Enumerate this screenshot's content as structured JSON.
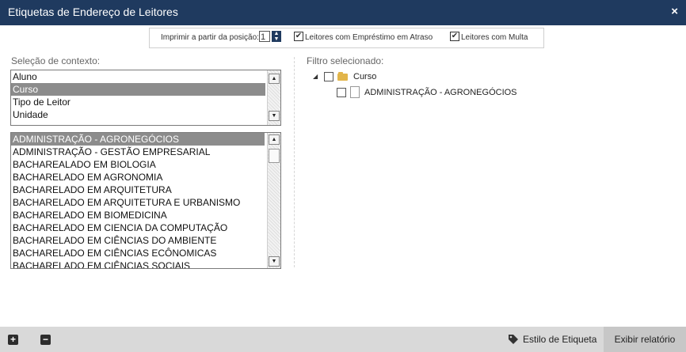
{
  "window": {
    "title": "Etiquetas de Endereço de Leitores",
    "close_glyph": "×"
  },
  "options": {
    "start_position_label": "Imprimir a partir da posição:",
    "start_position_value": "1",
    "overdue_loans_label": "Leitores com Empréstimo em Atraso",
    "overdue_loans_checked": true,
    "fines_label": "Leitores com Multa",
    "fines_checked": true
  },
  "context": {
    "label": "Seleção de contexto:",
    "types": [
      "Aluno",
      "Curso",
      "Tipo de Leitor",
      "Unidade"
    ],
    "selected_type": "Curso",
    "values": [
      "ADMINISTRAÇÃO - AGRONEGÓCIOS",
      "ADMINISTRAÇÃO - GESTÃO EMPRESARIAL",
      "BACHAREALADO EM BIOLOGIA",
      "BACHARELADO EM AGRONOMIA",
      "BACHARELADO EM ARQUITETURA",
      "BACHARELADO EM ARQUITETURA E URBANISMO",
      "BACHARELADO EM BIOMEDICINA",
      "BACHARELADO EM CIENCIA DA COMPUTAÇÃO",
      "BACHARELADO EM CIÊNCIAS DO AMBIENTE",
      "BACHARELADO EM CIÊNCIAS ECÔNOMICAS",
      "BACHARELADO EM CIÊNCIAS SOCIAIS"
    ],
    "selected_value": "ADMINISTRAÇÃO - AGRONEGÓCIOS"
  },
  "filter": {
    "label": "Filtro selecionado:",
    "root": "Curso",
    "child": "ADMINISTRAÇÃO - AGRONEGÓCIOS"
  },
  "footer": {
    "add_glyph": "+",
    "remove_glyph": "−",
    "label_style": "Estilo de Etiqueta",
    "show_report": "Exibir relatório"
  },
  "icons": {
    "close": "close-icon",
    "spinner": "spinner-arrows-icon",
    "folder": "folder-icon",
    "document": "document-icon",
    "tag": "tag-icon",
    "add": "plus-icon",
    "remove": "minus-icon"
  },
  "colors": {
    "titlebar": "#1f3a5f",
    "selection": "#8c8c8c",
    "footer": "#d9d9d9",
    "report_button": "#c7c7c7"
  }
}
